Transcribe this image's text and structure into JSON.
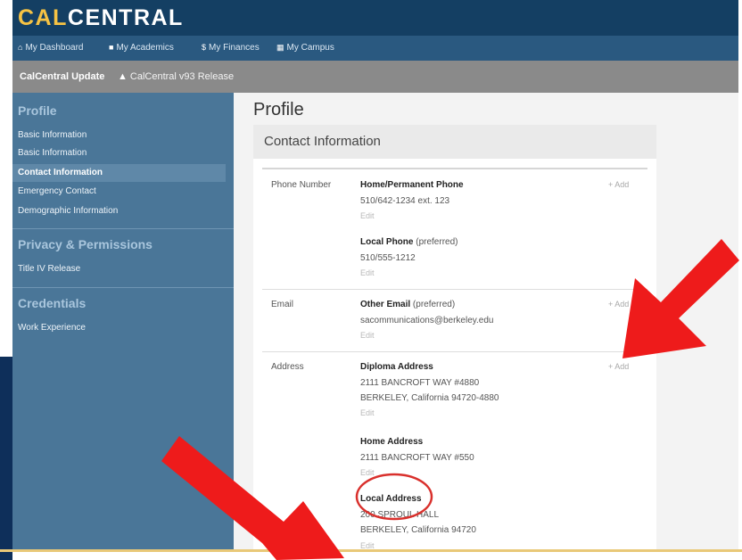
{
  "header": {
    "brand_cal": "CAL",
    "brand_central": "CENTRAL"
  },
  "nav": {
    "items": [
      {
        "icon": "home-icon",
        "glyph": "⌂",
        "label": "My Dashboard"
      },
      {
        "icon": "book-icon",
        "glyph": "■",
        "label": "My Academics"
      },
      {
        "icon": "dollar-icon",
        "glyph": "$",
        "label": "My Finances"
      },
      {
        "icon": "grid-icon",
        "glyph": "▦",
        "label": "My Campus"
      }
    ]
  },
  "update": {
    "title": "CalCentral Update",
    "link_icon": "warning-icon",
    "link_glyph": "▲",
    "link_label": "CalCentral v93 Release"
  },
  "sidebar": {
    "sections": [
      {
        "heading": "Profile",
        "items": [
          "Basic Information",
          "Basic Information",
          "Contact Information",
          "Emergency Contact",
          "Demographic Information"
        ]
      },
      {
        "heading": "Privacy & Permissions",
        "items": [
          "Title IV Release"
        ]
      },
      {
        "heading": "Credentials",
        "items": [
          "Work Experience"
        ]
      }
    ],
    "active_item": "Contact Information"
  },
  "main": {
    "title": "Profile",
    "card_title": "Contact Information",
    "add_label": "+ Add",
    "edit_label": "Edit",
    "phone": {
      "label": "Phone Number",
      "entries": [
        {
          "title": "Home/Permanent Phone",
          "note": "",
          "lines": [
            "510/642-1234 ext. 123"
          ]
        },
        {
          "title": "Local Phone",
          "note": "(preferred)",
          "lines": [
            "510/555-1212"
          ]
        }
      ]
    },
    "email": {
      "label": "Email",
      "entries": [
        {
          "title": "Other Email",
          "note": "(preferred)",
          "lines": [
            "sacommunications@berkeley.edu"
          ]
        }
      ]
    },
    "address": {
      "label": "Address",
      "entries": [
        {
          "title": "Diploma Address",
          "note": "",
          "lines": [
            "2111 BANCROFT WAY #4880",
            "BERKELEY, California 94720-4880"
          ]
        },
        {
          "title": "Home Address",
          "note": "",
          "lines": [
            "2111 BANCROFT WAY #550"
          ]
        },
        {
          "title": "Local Address",
          "note": "",
          "lines": [
            "200 SPROUL HALL",
            "BERKELEY, California 94720"
          ]
        }
      ]
    }
  },
  "annotations": {
    "arrow_color": "#ee1b1b",
    "circle_color": "#d9302c"
  }
}
